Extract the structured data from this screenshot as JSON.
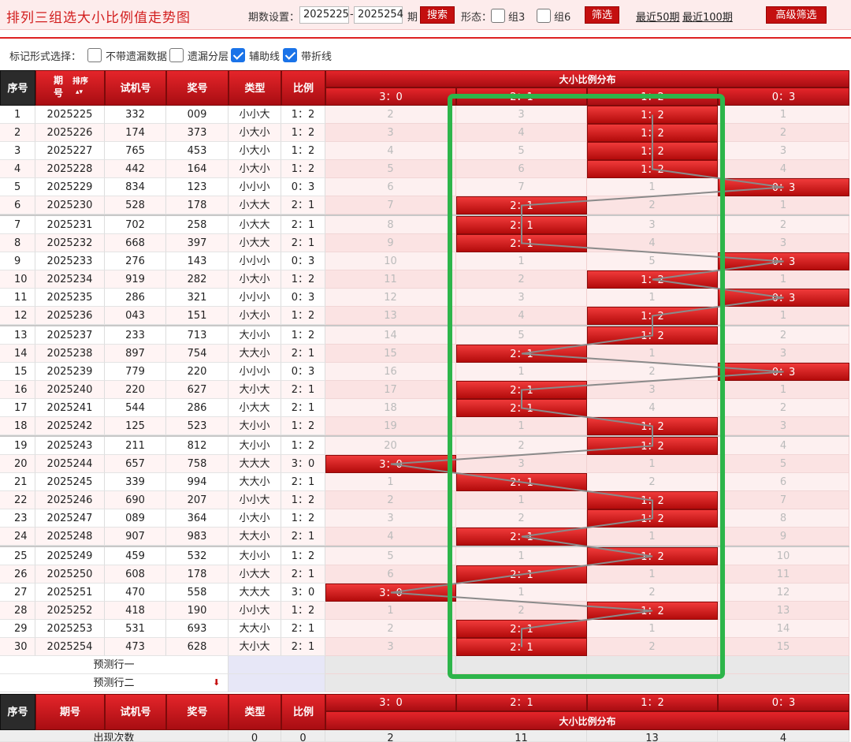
{
  "header": {
    "title": "排列三组选大小比例值走势图",
    "period_label": "期数设置：",
    "start_period": "2025225",
    "dash": "-",
    "end_period": "2025254",
    "period_unit": "期",
    "search_label": "搜索",
    "form_label": "形态：",
    "group3_label": "组3",
    "group6_label": "组6",
    "filter_label": "筛选",
    "recent50_label": "最近50期",
    "recent100_label": "最近100期",
    "advanced_label": "高级筛选"
  },
  "mark_options": {
    "label": "标记形式选择：",
    "items": [
      {
        "label": "不带遗漏数据",
        "checked": false
      },
      {
        "label": "遗漏分层",
        "checked": false
      },
      {
        "label": "辅助线",
        "checked": true
      },
      {
        "label": "带折线",
        "checked": true
      }
    ]
  },
  "table": {
    "columns": {
      "index": "序号",
      "period": "期号",
      "sort": "排序",
      "test": "试机号",
      "prize": "奖号",
      "type": "类型",
      "ratio": "比例",
      "dist": "大小比例分布"
    },
    "dist_columns": [
      "3：0",
      "2：1",
      "1：2",
      "0：3"
    ],
    "rows": [
      {
        "i": "1",
        "period": "2025225",
        "test": "332",
        "prize": "009",
        "type": "小小大",
        "ratio": "1：2",
        "hit": 2,
        "miss": [
          "2",
          "3",
          "1：2",
          "1"
        ]
      },
      {
        "i": "2",
        "period": "2025226",
        "test": "174",
        "prize": "373",
        "type": "小大小",
        "ratio": "1：2",
        "hit": 2,
        "miss": [
          "3",
          "4",
          "1：2",
          "2"
        ]
      },
      {
        "i": "3",
        "period": "2025227",
        "test": "765",
        "prize": "453",
        "type": "小大小",
        "ratio": "1：2",
        "hit": 2,
        "miss": [
          "4",
          "5",
          "1：2",
          "3"
        ]
      },
      {
        "i": "4",
        "period": "2025228",
        "test": "442",
        "prize": "164",
        "type": "小大小",
        "ratio": "1：2",
        "hit": 2,
        "miss": [
          "5",
          "6",
          "1：2",
          "4"
        ]
      },
      {
        "i": "5",
        "period": "2025229",
        "test": "834",
        "prize": "123",
        "type": "小小小",
        "ratio": "0：3",
        "hit": 3,
        "miss": [
          "6",
          "7",
          "1",
          "0：3"
        ]
      },
      {
        "i": "6",
        "period": "2025230",
        "test": "528",
        "prize": "178",
        "type": "小大大",
        "ratio": "2：1",
        "hit": 1,
        "miss": [
          "7",
          "2：1",
          "2",
          "1"
        ]
      },
      {
        "i": "7",
        "period": "2025231",
        "test": "702",
        "prize": "258",
        "type": "小大大",
        "ratio": "2：1",
        "hit": 1,
        "miss": [
          "8",
          "2：1",
          "3",
          "2"
        ]
      },
      {
        "i": "8",
        "period": "2025232",
        "test": "668",
        "prize": "397",
        "type": "小大大",
        "ratio": "2：1",
        "hit": 1,
        "miss": [
          "9",
          "2：1",
          "4",
          "3"
        ]
      },
      {
        "i": "9",
        "period": "2025233",
        "test": "276",
        "prize": "143",
        "type": "小小小",
        "ratio": "0：3",
        "hit": 3,
        "miss": [
          "10",
          "1",
          "5",
          "0：3"
        ]
      },
      {
        "i": "10",
        "period": "2025234",
        "test": "919",
        "prize": "282",
        "type": "小大小",
        "ratio": "1：2",
        "hit": 2,
        "miss": [
          "11",
          "2",
          "1：2",
          "1"
        ]
      },
      {
        "i": "11",
        "period": "2025235",
        "test": "286",
        "prize": "321",
        "type": "小小小",
        "ratio": "0：3",
        "hit": 3,
        "miss": [
          "12",
          "3",
          "1",
          "0：3"
        ]
      },
      {
        "i": "12",
        "period": "2025236",
        "test": "043",
        "prize": "151",
        "type": "小大小",
        "ratio": "1：2",
        "hit": 2,
        "miss": [
          "13",
          "4",
          "1：2",
          "1"
        ]
      },
      {
        "i": "13",
        "period": "2025237",
        "test": "233",
        "prize": "713",
        "type": "大小小",
        "ratio": "1：2",
        "hit": 2,
        "miss": [
          "14",
          "5",
          "1：2",
          "2"
        ]
      },
      {
        "i": "14",
        "period": "2025238",
        "test": "897",
        "prize": "754",
        "type": "大大小",
        "ratio": "2：1",
        "hit": 1,
        "miss": [
          "15",
          "2：1",
          "1",
          "3"
        ]
      },
      {
        "i": "15",
        "period": "2025239",
        "test": "779",
        "prize": "220",
        "type": "小小小",
        "ratio": "0：3",
        "hit": 3,
        "miss": [
          "16",
          "1",
          "2",
          "0：3"
        ]
      },
      {
        "i": "16",
        "period": "2025240",
        "test": "220",
        "prize": "627",
        "type": "大小大",
        "ratio": "2：1",
        "hit": 1,
        "miss": [
          "17",
          "2：1",
          "3",
          "1"
        ]
      },
      {
        "i": "17",
        "period": "2025241",
        "test": "544",
        "prize": "286",
        "type": "小大大",
        "ratio": "2：1",
        "hit": 1,
        "miss": [
          "18",
          "2：1",
          "4",
          "2"
        ]
      },
      {
        "i": "18",
        "period": "2025242",
        "test": "125",
        "prize": "523",
        "type": "大小小",
        "ratio": "1：2",
        "hit": 2,
        "miss": [
          "19",
          "1",
          "1：2",
          "3"
        ]
      },
      {
        "i": "19",
        "period": "2025243",
        "test": "211",
        "prize": "812",
        "type": "大小小",
        "ratio": "1：2",
        "hit": 2,
        "miss": [
          "20",
          "2",
          "1：2",
          "4"
        ]
      },
      {
        "i": "20",
        "period": "2025244",
        "test": "657",
        "prize": "758",
        "type": "大大大",
        "ratio": "3：0",
        "hit": 0,
        "miss": [
          "3：0",
          "3",
          "1",
          "5"
        ]
      },
      {
        "i": "21",
        "period": "2025245",
        "test": "339",
        "prize": "994",
        "type": "大大小",
        "ratio": "2：1",
        "hit": 1,
        "miss": [
          "1",
          "2：1",
          "2",
          "6"
        ]
      },
      {
        "i": "22",
        "period": "2025246",
        "test": "690",
        "prize": "207",
        "type": "小小大",
        "ratio": "1：2",
        "hit": 2,
        "miss": [
          "2",
          "1",
          "1：2",
          "7"
        ]
      },
      {
        "i": "23",
        "period": "2025247",
        "test": "089",
        "prize": "364",
        "type": "小大小",
        "ratio": "1：2",
        "hit": 2,
        "miss": [
          "3",
          "2",
          "1：2",
          "8"
        ]
      },
      {
        "i": "24",
        "period": "2025248",
        "test": "907",
        "prize": "983",
        "type": "大大小",
        "ratio": "2：1",
        "hit": 1,
        "miss": [
          "4",
          "2：1",
          "1",
          "9"
        ]
      },
      {
        "i": "25",
        "period": "2025249",
        "test": "459",
        "prize": "532",
        "type": "大小小",
        "ratio": "1：2",
        "hit": 2,
        "miss": [
          "5",
          "1",
          "1：2",
          "10"
        ]
      },
      {
        "i": "26",
        "period": "2025250",
        "test": "608",
        "prize": "178",
        "type": "小大大",
        "ratio": "2：1",
        "hit": 1,
        "miss": [
          "6",
          "2：1",
          "1",
          "11"
        ]
      },
      {
        "i": "27",
        "period": "2025251",
        "test": "470",
        "prize": "558",
        "type": "大大大",
        "ratio": "3：0",
        "hit": 0,
        "miss": [
          "3：0",
          "1",
          "2",
          "12"
        ]
      },
      {
        "i": "28",
        "period": "2025252",
        "test": "418",
        "prize": "190",
        "type": "小小大",
        "ratio": "1：2",
        "hit": 2,
        "miss": [
          "1",
          "2",
          "1：2",
          "13"
        ]
      },
      {
        "i": "29",
        "period": "2025253",
        "test": "531",
        "prize": "693",
        "type": "大大小",
        "ratio": "2：1",
        "hit": 1,
        "miss": [
          "2",
          "2：1",
          "1",
          "14"
        ]
      },
      {
        "i": "30",
        "period": "2025254",
        "test": "473",
        "prize": "628",
        "type": "大小大",
        "ratio": "2：1",
        "hit": 1,
        "miss": [
          "3",
          "2：1",
          "2",
          "15"
        ]
      }
    ],
    "predict_rows": [
      "预测行一",
      "预测行二"
    ],
    "footer": {
      "index": "序号",
      "period": "期号",
      "test": "试机号",
      "prize": "奖号",
      "type": "类型",
      "ratio": "比例",
      "dist": "大小比例分布",
      "count_label": "出现次数",
      "count_type": "0",
      "count_ratio": "0",
      "counts": [
        "2",
        "11",
        "13",
        "4"
      ]
    }
  },
  "colors": {
    "accent_red": "#d21e1e",
    "highlight_green": "#2db54a",
    "trend_line": "#8a8a8a"
  }
}
